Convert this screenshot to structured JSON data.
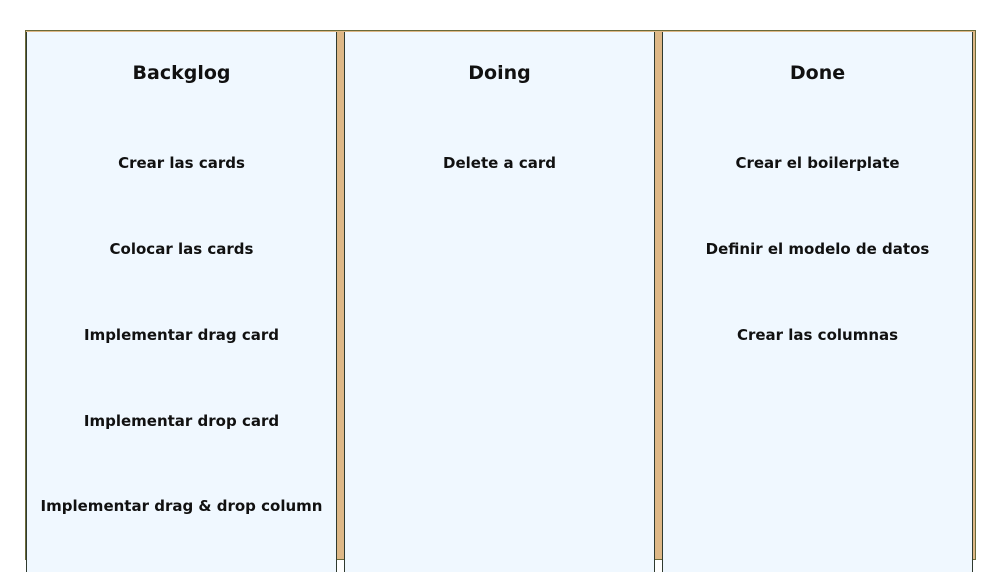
{
  "board": {
    "columns": [
      {
        "title": "Backglog",
        "cards": [
          "Crear las cards",
          "Colocar las cards",
          "Implementar drag card",
          "Implementar drop card",
          "Implementar drag & drop column"
        ]
      },
      {
        "title": "Doing",
        "cards": [
          "Delete a card"
        ]
      },
      {
        "title": "Done",
        "cards": [
          "Crear el boilerplate",
          "Definir el modelo de datos",
          "Crear las columnas"
        ]
      }
    ]
  },
  "colors": {
    "column_bg": "#f0f8ff",
    "board_gap": "#deb887",
    "text": "#111111"
  }
}
